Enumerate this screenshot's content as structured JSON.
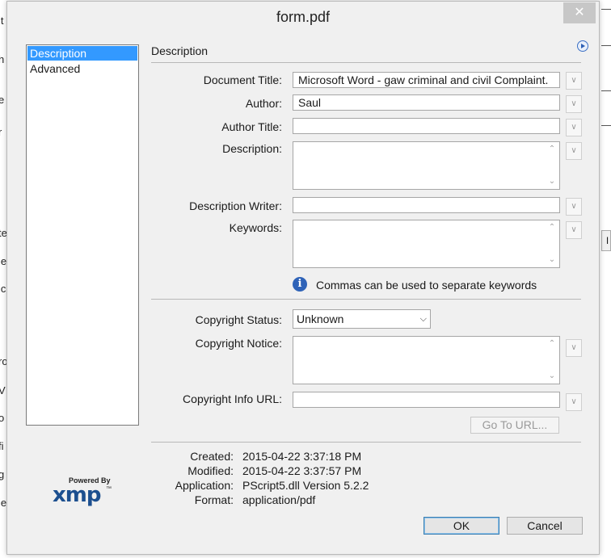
{
  "window": {
    "title": "form.pdf"
  },
  "categories": [
    "Description",
    "Advanced"
  ],
  "section_title": "Description",
  "fields": {
    "document_title": {
      "label": "Document Title:",
      "value": "Microsoft Word - gaw criminal and civil Complaint."
    },
    "author": {
      "label": "Author:",
      "value": "Saul"
    },
    "author_title": {
      "label": "Author Title:",
      "value": ""
    },
    "description": {
      "label": "Description:",
      "value": ""
    },
    "description_writer": {
      "label": "Description Writer:",
      "value": ""
    },
    "keywords": {
      "label": "Keywords:",
      "value": ""
    }
  },
  "keywords_hint": "Commas can be used to separate keywords",
  "copyright": {
    "status_label": "Copyright Status:",
    "status_value": "Unknown",
    "notice_label": "Copyright Notice:",
    "url_label": "Copyright Info URL:",
    "goto_label": "Go To URL..."
  },
  "meta": {
    "created_label": "Created:",
    "created_value": "2015-04-22 3:37:18 PM",
    "modified_label": "Modified:",
    "modified_value": "2015-04-22 3:37:57 PM",
    "application_label": "Application:",
    "application_value": "PScript5.dll Version 5.2.2",
    "format_label": "Format:",
    "format_value": "application/pdf"
  },
  "branding": {
    "powered_by": "Powered By",
    "logo": "xmp"
  },
  "buttons": {
    "ok": "OK",
    "cancel": "Cancel",
    "close": "✕"
  },
  "colors": {
    "selection": "#3399ff",
    "info_icon": "#2f63b8",
    "xmp_logo": "#1c4f8f"
  }
}
